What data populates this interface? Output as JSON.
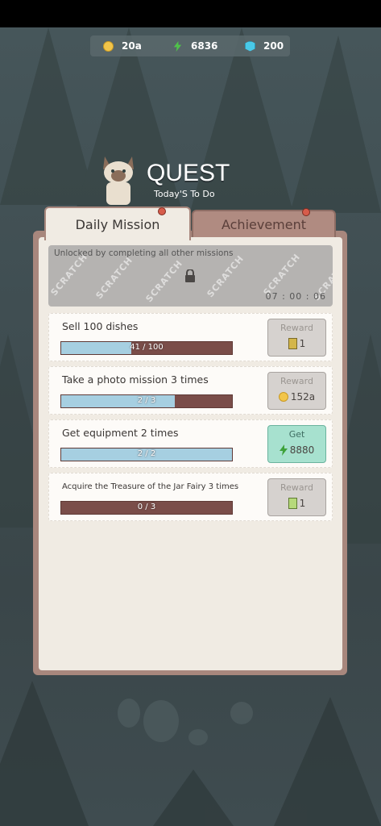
{
  "currencies": [
    {
      "icon": "coin-icon",
      "value": "20a",
      "color": "#f2c54a"
    },
    {
      "icon": "lightning-icon",
      "value": "6836",
      "color": "#4fc24a"
    },
    {
      "icon": "gem-icon",
      "value": "200",
      "color": "#49c9e8"
    }
  ],
  "header": {
    "title": "QUEST",
    "subtitle": "Today'S To Do"
  },
  "tabs": [
    {
      "label": "Daily Mission",
      "active": true,
      "notification": true
    },
    {
      "label": "Achievement",
      "active": false,
      "notification": true
    }
  ],
  "locked_mission": {
    "text": "Unlocked by completing all other missions",
    "timer": "07 : 00 : 06",
    "watermark": "SCRATCH"
  },
  "missions": [
    {
      "label": "Sell 100 dishes",
      "progress_text": "41 / 100",
      "progress": 0.41,
      "button_label": "Reward",
      "reward_icon": "ticket-icon",
      "reward_value": "1",
      "state": "reward"
    },
    {
      "label": "Take a photo mission 3 times",
      "progress_text": "2 / 3",
      "progress": 0.667,
      "button_label": "Reward",
      "reward_icon": "coin-icon",
      "reward_value": "152a",
      "state": "reward"
    },
    {
      "label": "Get equipment 2 times",
      "progress_text": "2 / 2",
      "progress": 1.0,
      "button_label": "Get",
      "reward_icon": "lightning-icon",
      "reward_value": "8880",
      "state": "get"
    },
    {
      "label": "Acquire the Treasure of the Jar Fairy 3 times",
      "progress_text": "0 / 3",
      "progress": 0.0,
      "button_label": "Reward",
      "reward_icon": "ticket-green-icon",
      "reward_value": "1",
      "state": "reward"
    }
  ]
}
